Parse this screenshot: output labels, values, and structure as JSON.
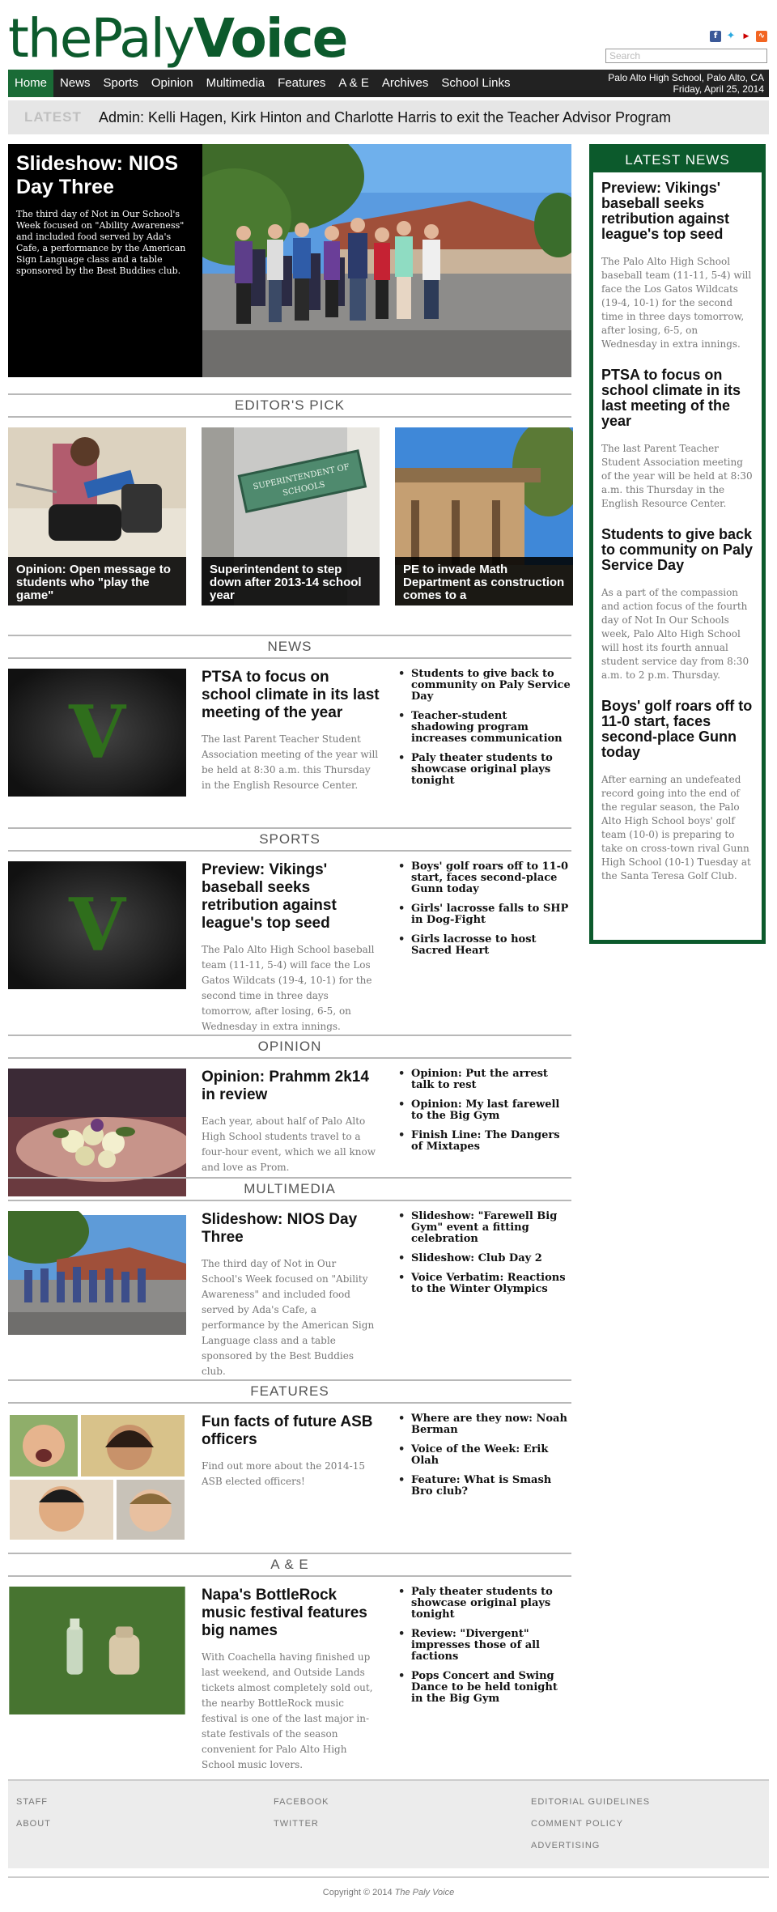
{
  "header": {
    "logo_the": "the",
    "logo_paly": "Paly",
    "logo_voice": "Voice",
    "search_placeholder": "Search",
    "social": [
      "facebook-icon",
      "twitter-icon",
      "youtube-icon",
      "rss-icon"
    ]
  },
  "nav": {
    "items": [
      "Home",
      "News",
      "Sports",
      "Opinion",
      "Multimedia",
      "Features",
      "A & E",
      "Archives",
      "School Links"
    ],
    "location": "Palo Alto High School, Palo Alto, CA",
    "date": "Friday, April 25, 2014"
  },
  "ticker": {
    "label": "LATEST",
    "text": "Admin: Kelli Hagen, Kirk Hinton and Charlotte Harris to exit the Teacher Advisor Program"
  },
  "hero": {
    "title": "Slideshow: NIOS Day Three",
    "description": "The third day of Not in Our School's Week focused on \"Ability Awareness\" and included food served by Ada's Cafe, a performance by the American Sign Language class and a table sponsored by the Best Buddies club."
  },
  "editors_pick": {
    "heading": "EDITOR'S PICK",
    "items": [
      {
        "caption": "Opinion: Open message to students who \"play the game\""
      },
      {
        "caption": "Superintendent to step down after 2013-14 school year"
      },
      {
        "caption": "PE to invade Math Department as construction comes to a"
      }
    ],
    "sign_text": "SUPERINTENDENT OF SCHOOLS"
  },
  "sections": {
    "news": {
      "heading": "NEWS",
      "title": "PTSA to focus on school climate in its last meeting of the year",
      "desc": "The last Parent Teacher Student Association meeting of the year will be held at 8:30 a.m. this Thursday in the English Resource Center.",
      "links": [
        "Students to give back to community on Paly Service Day",
        "Teacher-student shadowing program increases communication",
        "Paly theater students to showcase original plays tonight"
      ]
    },
    "sports": {
      "heading": "SPORTS",
      "title": "Preview: Vikings' baseball seeks retribution against league's top seed",
      "desc": "The Palo Alto High School baseball team (11-11, 5-4) will face the Los Gatos Wildcats (19-4, 10-1) for the second time in three days tomorrow, after losing, 6-5, on Wednesday in extra innings.",
      "links": [
        "Boys' golf roars off to 11-0 start, faces second-place Gunn today",
        "Girls' lacrosse falls to SHP in Dog-Fight",
        "Girls lacrosse to host Sacred Heart"
      ]
    },
    "opinion": {
      "heading": "OPINION",
      "title": "Opinion: Prahmm 2k14 in review",
      "desc": "Each year, about half of Palo Alto High School students travel to a four-hour event, which we all know and love as Prom.",
      "links": [
        "Opinion: Put the arrest talk to rest",
        "Opinion: My last farewell to the Big Gym",
        "Finish Line: The Dangers of Mixtapes"
      ]
    },
    "multimedia": {
      "heading": "MULTIMEDIA",
      "title": "Slideshow: NIOS Day Three",
      "desc": "The third day of Not in Our School's Week focused on \"Ability Awareness\" and included food served by Ada's Cafe, a performance by the American Sign Language class and a table sponsored by the Best Buddies club.",
      "links": [
        "Slideshow: \"Farewell Big Gym\" event a fitting celebration",
        "Slideshow: Club Day 2",
        "Voice Verbatim: Reactions to the Winter Olympics"
      ]
    },
    "features": {
      "heading": "FEATURES",
      "title": "Fun facts of future ASB officers",
      "desc": "Find out more about the 2014-15 ASB elected officers!",
      "links": [
        "Where are they now: Noah Berman",
        "Voice of the Week: Erik Olah",
        "Feature: What is Smash Bro club?"
      ]
    },
    "ae": {
      "heading": "A & E",
      "title": "Napa's BottleRock music festival features big names",
      "desc": "With Coachella having finished up last weekend, and Outside Lands tickets almost completely sold out, the nearby BottleRock music festival is one of the last major in-state festivals of the season convenient for Palo Alto High School music lovers.",
      "links": [
        "Paly theater students to showcase original plays tonight",
        "Review: \"Divergent\" impresses those of all factions",
        "Pops Concert and Swing Dance to be held tonight in the Big Gym"
      ]
    }
  },
  "latest_news": {
    "heading": "LATEST NEWS",
    "items": [
      {
        "title": "Preview: Vikings' baseball seeks retribution against league's top seed",
        "desc": "The Palo Alto High School baseball team (11-11, 5-4) will face the Los Gatos Wildcats (19-4, 10-1) for the second time in three days tomorrow, after losing, 6-5, on Wednesday in extra innings."
      },
      {
        "title": "PTSA to focus on school climate in its last meeting of the year",
        "desc": "The last Parent Teacher Student Association meeting of the year will be held at 8:30 a.m. this Thursday in the English Resource Center."
      },
      {
        "title": "Students to give back to community on Paly Service Day",
        "desc": "As a part of the compassion and action focus of the fourth day of Not In Our Schools week, Palo Alto High School will host its fourth annual student service day from 8:30 a.m. to 2 p.m. Thursday."
      },
      {
        "title": "Boys' golf roars off to 11-0 start, faces second-place Gunn today",
        "desc": "After earning an undefeated record going into the end of the regular season, the Palo Alto High School boys' golf team (10-0) is preparing to take on cross-town rival Gunn High School (10-1) Tuesday at the Santa Teresa Golf Club."
      }
    ]
  },
  "footer": {
    "col1": [
      "STAFF",
      "ABOUT"
    ],
    "col2": [
      "FACEBOOK",
      "TWITTER"
    ],
    "col3": [
      "EDITORIAL GUIDELINES",
      "COMMENT POLICY",
      "ADVERTISING"
    ],
    "copyright_prefix": "Copyright © 2014",
    "copyright_name": "The Paly Voice"
  },
  "colors": {
    "brand_green": "#0c5a2c",
    "nav_active": "#1a6b36",
    "nav_bg": "#222222"
  }
}
